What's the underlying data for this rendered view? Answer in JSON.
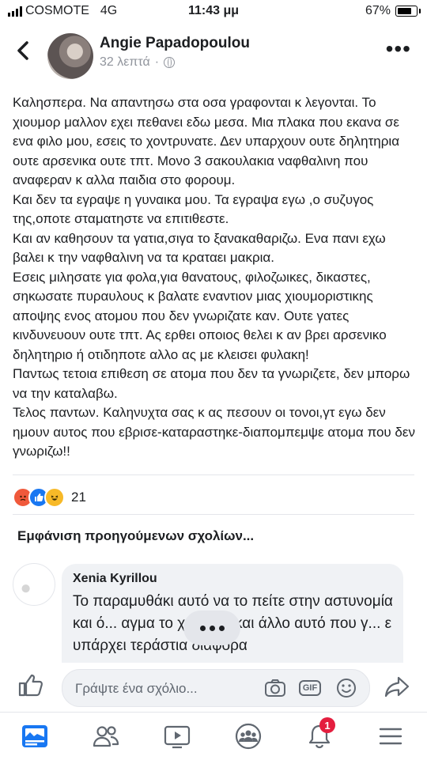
{
  "status_bar": {
    "carrier": "COSMOTE",
    "network": "4G",
    "time": "11:43 μμ",
    "battery": "67%"
  },
  "header": {
    "author": "Angie Papadopoulou",
    "time_ago": "32 λεπτά",
    "separator": "·"
  },
  "post": {
    "paragraphs": [
      "Καλησπερα. Να απαντησω στα οσα γραφονται κ λεγονται. Το χιουμορ μαλλον εχει πεθανει εδω μεσα. Μια πλακα που εκανα σε ενα φιλο μου, εσεις το χοντρυνατε. Δεν υπαρχουν ουτε δηλητηρια ουτε αρσενικα ουτε τπτ. Μονο 3 σακουλακια ναφθαλινη που αναφεραν κ αλλα παιδια στο φορουμ.",
      "Και δεν τα εγραψε η γυναικα μου. Τα εγραψα εγω ,ο συζυγος της,οποτε σταματηστε να επιτιθεστε.",
      "Και αν καθησουν τα γατια,σιγα το ξανακαθαριζω. Ενα πανι εχω βαλει κ την ναφθαλινη να τα κραταει μακρια.",
      "Εσεις μιλησατε για φολα,για θανατους, φιλοζωικες, δικαστες, σηκωσατε πυραυλους κ βαλατε εναντιον μιας χιουμοριστικης αποψης ενος ατομου που δεν γνωριζατε καν. Ουτε γατες κινδυνευουν ουτε τπτ. Ας ερθει οποιος θελει κ αν βρει αρσενικο δηλητηριο ή οτιδηποτε αλλο ας με κλεισει φυλακη!",
      "Παντως τετοια επιθεση σε ατομα που δεν τα γνωριζετε, δεν μπορω να την καταλαβω.",
      "Τελος παντων. Καληνυχτα σας κ ας πεσουν οι τονοι,γτ εγω δεν  ημουν αυτος που εβρισε-καταραστηκε-διαπομπεμψε ατομα που δεν γνωριζω!!"
    ]
  },
  "reactions": {
    "count": "21",
    "types": [
      "angry",
      "like",
      "haha"
    ]
  },
  "comments": {
    "show_previous": "Εμφάνιση προηγούμενων σχολίων...",
    "items": [
      {
        "name": "Xenia Kyrillou",
        "text": "Το παραμυθάκι αυτό να το πείτε στην αστυνομία και ό... αγμα το χιουμορ και άλλο αυτό που γ... ε υπάρχει τεράστια διαφορα"
      }
    ]
  },
  "composer": {
    "placeholder": "Γράψτε ένα σχόλιο...",
    "gif_label": "GIF"
  },
  "tabbar": {
    "notifications_badge": "1"
  },
  "colors": {
    "accent": "#1877f2",
    "badge": "#e41e3f",
    "muted_text": "#90949c",
    "bubble": "#f0f2f5"
  },
  "icons": [
    "back-arrow-icon",
    "globe-icon",
    "more-icon",
    "like-icon",
    "camera-icon",
    "gif-icon",
    "emoji-icon",
    "share-icon",
    "news-feed-icon",
    "friends-icon",
    "watch-icon",
    "groups-icon",
    "bell-icon",
    "menu-icon"
  ]
}
